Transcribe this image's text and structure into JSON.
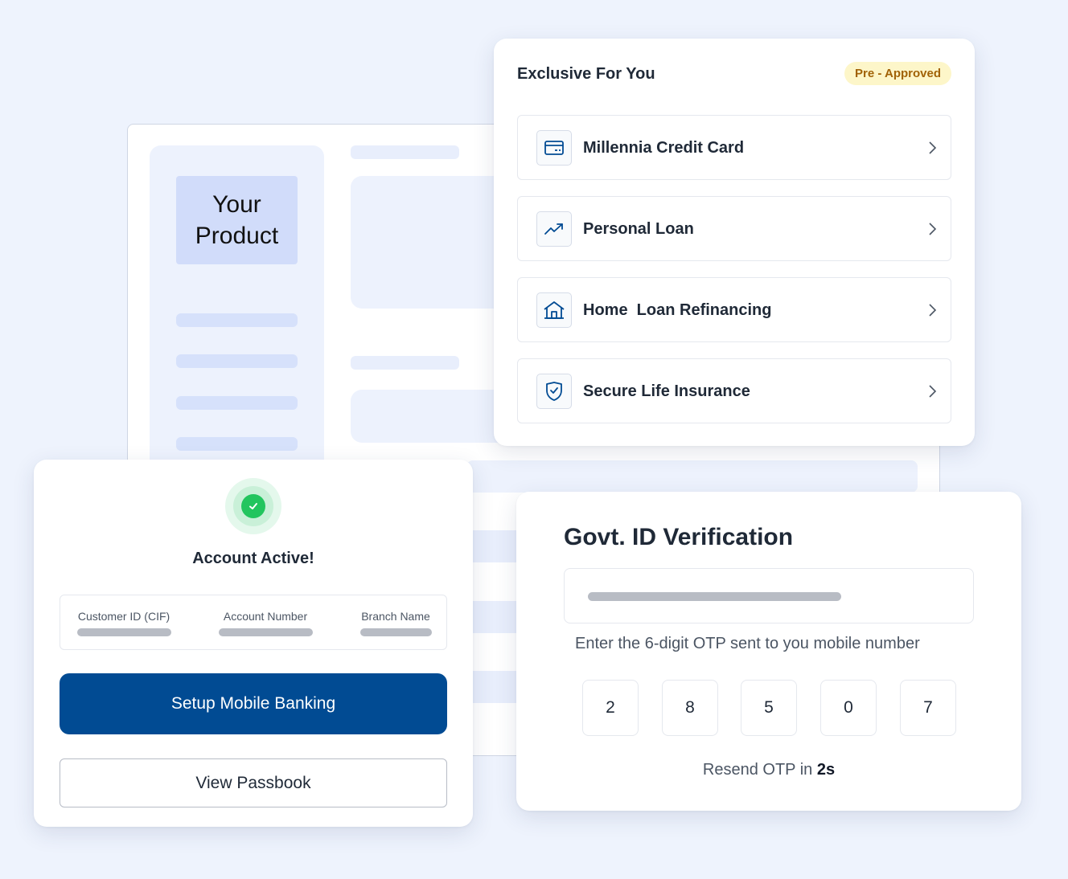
{
  "background": {
    "product_tile_text": "Your\nProduct"
  },
  "offers": {
    "title": "Exclusive For You",
    "badge": "Pre - Approved",
    "items": [
      {
        "label": "Millennia Credit Card",
        "icon": "credit-card-icon"
      },
      {
        "label": "Personal Loan",
        "icon": "trending-up-icon"
      },
      {
        "label": "Home  Loan Refinancing",
        "icon": "home-icon"
      },
      {
        "label": "Secure Life Insurance",
        "icon": "shield-check-icon"
      }
    ]
  },
  "account": {
    "title": "Account Active!",
    "status_icon": "check-circle-icon",
    "fields": [
      {
        "label": "Customer ID (CIF)"
      },
      {
        "label": "Account Number"
      },
      {
        "label": "Branch Name"
      }
    ],
    "primary_button": "Setup Mobile Banking",
    "secondary_button": "View Passbook"
  },
  "verification": {
    "title": "Govt. ID Verification",
    "otp_hint": "Enter the 6-digit OTP sent to you mobile number",
    "otp_digits": [
      "2",
      "8",
      "5",
      "0",
      "7"
    ],
    "resend_prefix": "Resend OTP in ",
    "resend_seconds": "2s"
  },
  "colors": {
    "page_background": "#eef3fd",
    "primary": "#014b93",
    "success": "#22c55e",
    "badge_bg": "#fdf6c9",
    "badge_text": "#a16207"
  }
}
